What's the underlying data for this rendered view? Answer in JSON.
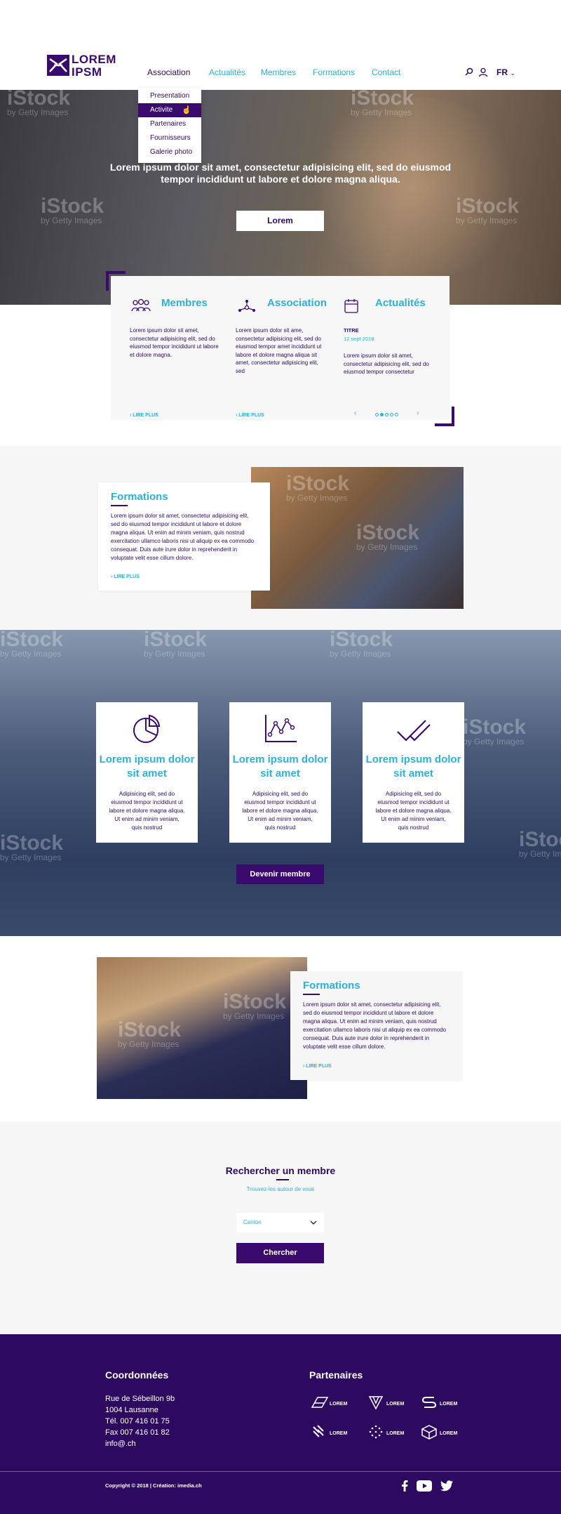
{
  "logo": {
    "line1": "LOREM",
    "line2": "IPSM"
  },
  "nav": {
    "items": [
      "Association",
      "Actualités",
      "Membres",
      "Formations",
      "Contact"
    ],
    "active": "Association",
    "lang": "FR"
  },
  "dropdown": {
    "items": [
      "Presentation",
      "Activite",
      "Partenaires",
      "Fournisseurs",
      "Galerie photo"
    ],
    "selected": "Activite"
  },
  "hero": {
    "text": "Lorem ipsum dolor sit amet, consectetur adipisicing elit, sed do eiusmod tempor incididunt ut labore et dolore magna aliqua.",
    "button": "Lorem"
  },
  "watermark": {
    "brand": "iStock",
    "sub": "by Getty Images"
  },
  "cards": {
    "membres": {
      "title": "Membres",
      "body": "Lorem ipsum dolor sit amet, consectetur adipisicing elit, sed do eiusmod tempor incididunt ut labore et dolore magna.",
      "link": "LIRE PLUS"
    },
    "association": {
      "title": "Association",
      "body": "Lorem ipsum dolor sit ame, consectetur adipisicing elit, sed do eiusmod tempor amet incididunt ut labore et dolore magna aliqua sit amet, consectetur adipisicing elit, sed",
      "link": "LIRE PLUS"
    },
    "actualites": {
      "title": "Actualités",
      "item_title": "TITRE",
      "item_date": "12 sept 2018",
      "body": "Lorem ipsum dolor sit amet, consectetur adipisicing elit, sed do eiusmod tempor consectetur",
      "slides": 5,
      "current_slide": 2
    }
  },
  "formations1": {
    "title": "Formations",
    "body": "Lorem ipsum dolor sit amet, consectetur adipisicing elit, sed do eiusmod tempor incididunt ut labore et dolore magna aliqua. Ut enim ad minim veniam, quis nostrud exercitation ullamco laboris nisi ut aliquip ex ea commodo consequat. Duis aute irure dolor in reprehenderit in voluptate velit esse cillum dolore.",
    "link": "LIRE PLUS"
  },
  "features": {
    "cards": [
      {
        "icon": "pie-chart-icon",
        "title": "Lorem ipsum dolor sit amet",
        "body": "Adipisicing elit, sed do eiusmod tempor incididunt ut labore et dolore magna aliqua. Ut enim ad minim veniam, quis nostrud"
      },
      {
        "icon": "line-chart-icon",
        "title": "Lorem ipsum dolor sit amet",
        "body": "Adipisicing elit, sed do eiusmod tempor incididunt ut labore et dolore magna aliqua. Ut enim ad minim veniam, quis nostrud"
      },
      {
        "icon": "double-check-icon",
        "title": "Lorem ipsum dolor sit amet",
        "body": "Adipisicing elit, sed do eiusmod tempor incididunt ut labore et dolore magna aliqua. Ut enim ad minim veniam, quis nostrud"
      }
    ],
    "button": "Devenir membre"
  },
  "formations2": {
    "title": "Formations",
    "body": "Lorem ipsum dolor sit amet, consectetur adipisicing elit, sed do eiusmod tempor incididunt ut labore et dolore magna aliqua. Ut enim ad minim veniam, quis nostrud exercitation ullamco laboris nisi ut aliquip ex ea commodo consequat. Duis aute irure dolor in reprehenderit in voluptate velit esse cillum dolore.",
    "link": "LIRE PLUS"
  },
  "search": {
    "title": "Rechercher un membre",
    "subtitle": "Trouvez-les autour de vous",
    "select_value": "Canton",
    "button": "Chercher"
  },
  "footer": {
    "contact_title": "Coordonnées",
    "address": [
      "Rue de Sébeillon 9b",
      "1004 Lausanne",
      "Tél. 007 416 01 75",
      "Fax 007 416 01 82",
      "info@.ch"
    ],
    "partners_title": "Partenaires",
    "partners": [
      "LOREM",
      "LOREM",
      "LOREM",
      "LOREM",
      "LOREM",
      "LOREM"
    ],
    "copyright": "Copyright © 2018 | Création: imedia.ch"
  },
  "colors": {
    "primary": "#3a0a6e",
    "accent": "#2bb1dc",
    "footer": "#2d0a5f",
    "section": "#f6f6f6"
  }
}
